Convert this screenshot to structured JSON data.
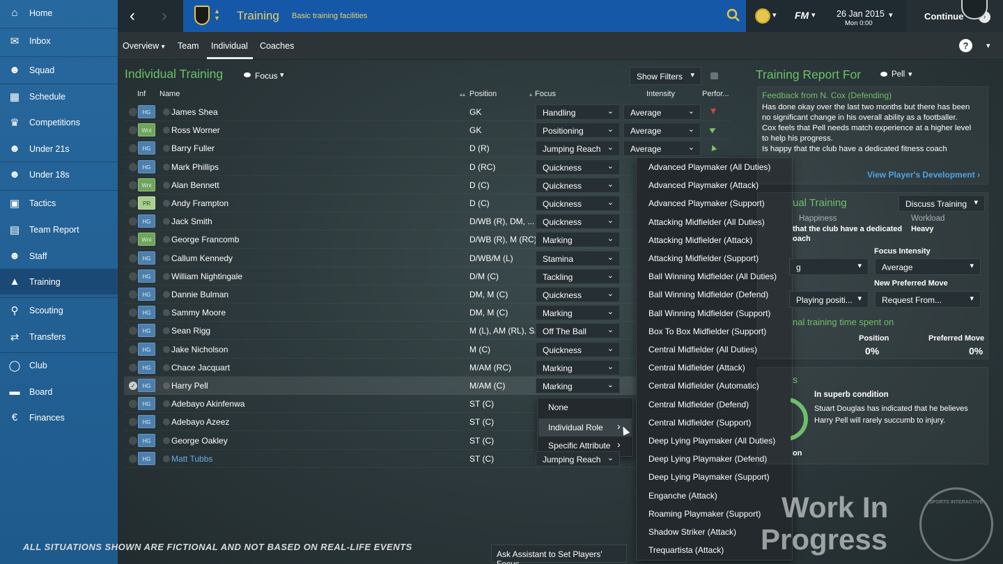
{
  "sidebar": {
    "items": [
      {
        "label": "Home",
        "icon": "home-icon"
      },
      {
        "label": "Inbox",
        "icon": "inbox-icon"
      },
      {
        "label": "Squad",
        "icon": "squad-icon"
      },
      {
        "label": "Schedule",
        "icon": "calendar-icon"
      },
      {
        "label": "Competitions",
        "icon": "trophy-icon"
      },
      {
        "label": "Under 21s",
        "icon": "group-icon"
      },
      {
        "label": "Under 18s",
        "icon": "group-icon"
      },
      {
        "label": "Tactics",
        "icon": "tactics-board-icon"
      },
      {
        "label": "Team Report",
        "icon": "report-icon"
      },
      {
        "label": "Staff",
        "icon": "staff-icon"
      },
      {
        "label": "Training",
        "icon": "training-cone-icon"
      },
      {
        "label": "Scouting",
        "icon": "magnifier-icon"
      },
      {
        "label": "Transfers",
        "icon": "transfer-icon"
      },
      {
        "label": "Club",
        "icon": "club-badge-icon"
      },
      {
        "label": "Board",
        "icon": "board-icon"
      },
      {
        "label": "Finances",
        "icon": "finance-coin-icon"
      }
    ]
  },
  "header": {
    "title": "Training",
    "subtitle": "Basic training facilities",
    "game_logo": "FM",
    "date": "26 Jan 2015",
    "time": "Mon 0:00",
    "continue_label": "Continue"
  },
  "tabs": [
    {
      "label": "Overview",
      "dropdown": true
    },
    {
      "label": "Team"
    },
    {
      "label": "Individual",
      "active": true
    },
    {
      "label": "Coaches"
    }
  ],
  "individual": {
    "heading": "Individual Training",
    "view_label": "Focus",
    "show_filters": "Show Filters",
    "columns": {
      "inf": "Inf",
      "name": "Name",
      "position": "Position",
      "focus": "Focus",
      "intensity": "Intensity",
      "performance": "Perfor..."
    },
    "players": [
      {
        "badge": "HG",
        "name": "James Shea",
        "position": "GK",
        "focus": "Handling",
        "intensity": "Average",
        "perf": "down"
      },
      {
        "badge": "Wnt",
        "name": "Ross Worner",
        "position": "GK",
        "focus": "Positioning",
        "intensity": "Average",
        "perf": "up-right"
      },
      {
        "badge": "HG",
        "name": "Barry Fuller",
        "position": "D (R)",
        "focus": "Jumping Reach",
        "intensity": "Average",
        "perf": "up"
      },
      {
        "badge": "HG",
        "name": "Mark Phillips",
        "position": "D (RC)",
        "focus": "Quickness"
      },
      {
        "badge": "Wnt",
        "name": "Alan Bennett",
        "position": "D (C)",
        "focus": "Quickness"
      },
      {
        "badge": "PR",
        "name": "Andy Frampton",
        "position": "D (C)",
        "focus": "Quickness"
      },
      {
        "badge": "HG",
        "name": "Jack Smith",
        "position": "D/WB (R), DM, ...",
        "focus": "Quickness"
      },
      {
        "badge": "Wnt",
        "name": "George Francomb",
        "position": "D/WB (R), M (RC)",
        "focus": "Marking"
      },
      {
        "badge": "HG",
        "name": "Callum Kennedy",
        "position": "D/WB/M (L)",
        "focus": "Stamina"
      },
      {
        "badge": "HG",
        "name": "William Nightingale",
        "position": "D/M (C)",
        "focus": "Tackling"
      },
      {
        "badge": "HG",
        "name": "Dannie Bulman",
        "position": "DM, M (C)",
        "focus": "Quickness"
      },
      {
        "badge": "HG",
        "name": "Sammy Moore",
        "position": "DM, M (C)",
        "focus": "Marking"
      },
      {
        "badge": "HG",
        "name": "Sean Rigg",
        "position": "M (L), AM (RL), S...",
        "focus": "Off The Ball"
      },
      {
        "badge": "HG",
        "name": "Jake Nicholson",
        "position": "M (C)",
        "focus": "Quickness"
      },
      {
        "badge": "HG",
        "name": "Chace Jacquart",
        "position": "M/AM (RC)",
        "focus": "Marking"
      },
      {
        "badge": "HG",
        "name": "Harry Pell",
        "position": "M/AM (C)",
        "focus": "Marking",
        "selected": true
      },
      {
        "badge": "HG",
        "name": "Adebayo Akinfenwa",
        "position": "ST (C)"
      },
      {
        "badge": "HG",
        "name": "Adebayo Azeez",
        "position": "ST (C)"
      },
      {
        "badge": "HG",
        "name": "George Oakley",
        "position": "ST (C)"
      },
      {
        "badge": "HG",
        "name": "Matt Tubbs",
        "position": "ST (C)",
        "focus": "Jumping Reach",
        "link": true
      }
    ],
    "ask_assistant": "Ask Assistant to Set Players' Focus"
  },
  "focus_menu": {
    "items": [
      "None",
      "Individual Role",
      "Specific Attribute"
    ]
  },
  "role_menu": {
    "items": [
      "Advanced Playmaker (All Duties)",
      "Advanced Playmaker (Attack)",
      "Advanced Playmaker (Support)",
      "Attacking Midfielder (All Duties)",
      "Attacking Midfielder (Attack)",
      "Attacking Midfielder (Support)",
      "Ball Winning Midfielder (All Duties)",
      "Ball Winning Midfielder (Defend)",
      "Ball Winning Midfielder (Support)",
      "Box To Box Midfielder (Support)",
      "Central Midfielder (All Duties)",
      "Central Midfielder (Attack)",
      "Central Midfielder (Automatic)",
      "Central Midfielder (Defend)",
      "Central Midfielder (Support)",
      "Deep Lying Playmaker (All Duties)",
      "Deep Lying Playmaker (Defend)",
      "Deep Lying Playmaker (Support)",
      "Enganche (Attack)",
      "Roaming Playmaker (Support)",
      "Shadow Striker (Attack)",
      "Trequartista (Attack)"
    ]
  },
  "report": {
    "heading": "Training Report For",
    "player": "Pell",
    "feedback_title": "Feedback from N. Cox (Defending)",
    "feedback_lines": [
      "Has done okay over the last two months but there has been",
      "no significant change in his overall ability as a footballer.",
      "Cox feels that Pell needs match experience at a higher level",
      "to help his progress.",
      "Is happy that the club have a dedicated fitness coach"
    ],
    "view_dev": "View Player's Development",
    "indiv_heading": "ual Training",
    "discuss": "Discuss Training",
    "happiness_label": "Happiness",
    "happiness_text1": "that the club have a dedicated",
    "happiness_text2": "oach",
    "workload_label": "Workload",
    "workload_value": "Heavy",
    "focus_intensity_label": "Focus Intensity",
    "focus_intensity_value": "Average",
    "partial_value": "g",
    "new_pref_label": "New Preferred Move",
    "playing_pos": "Playing positi...",
    "request_from": "Request From...",
    "time_spent": "nal training time spent on",
    "position_label": "Position",
    "position_value": "0%",
    "pref_move_label": "Preferred Move",
    "pref_move_value": "0%",
    "partial_s": "s",
    "condition_title": "In superb condition",
    "condition_text1": "Stuart Douglas has indicated that he believes",
    "condition_text2": "Harry Pell will rarely succumb to injury.",
    "partial_on": "on"
  },
  "footer": {
    "disclaimer": "ALL SITUATIONS SHOWN ARE FICTIONAL AND NOT BASED ON REAL-LIFE EVENTS",
    "wip1": "Work In",
    "wip2": "Progress",
    "si_logo": "SPORTS INTERACTIVE"
  }
}
